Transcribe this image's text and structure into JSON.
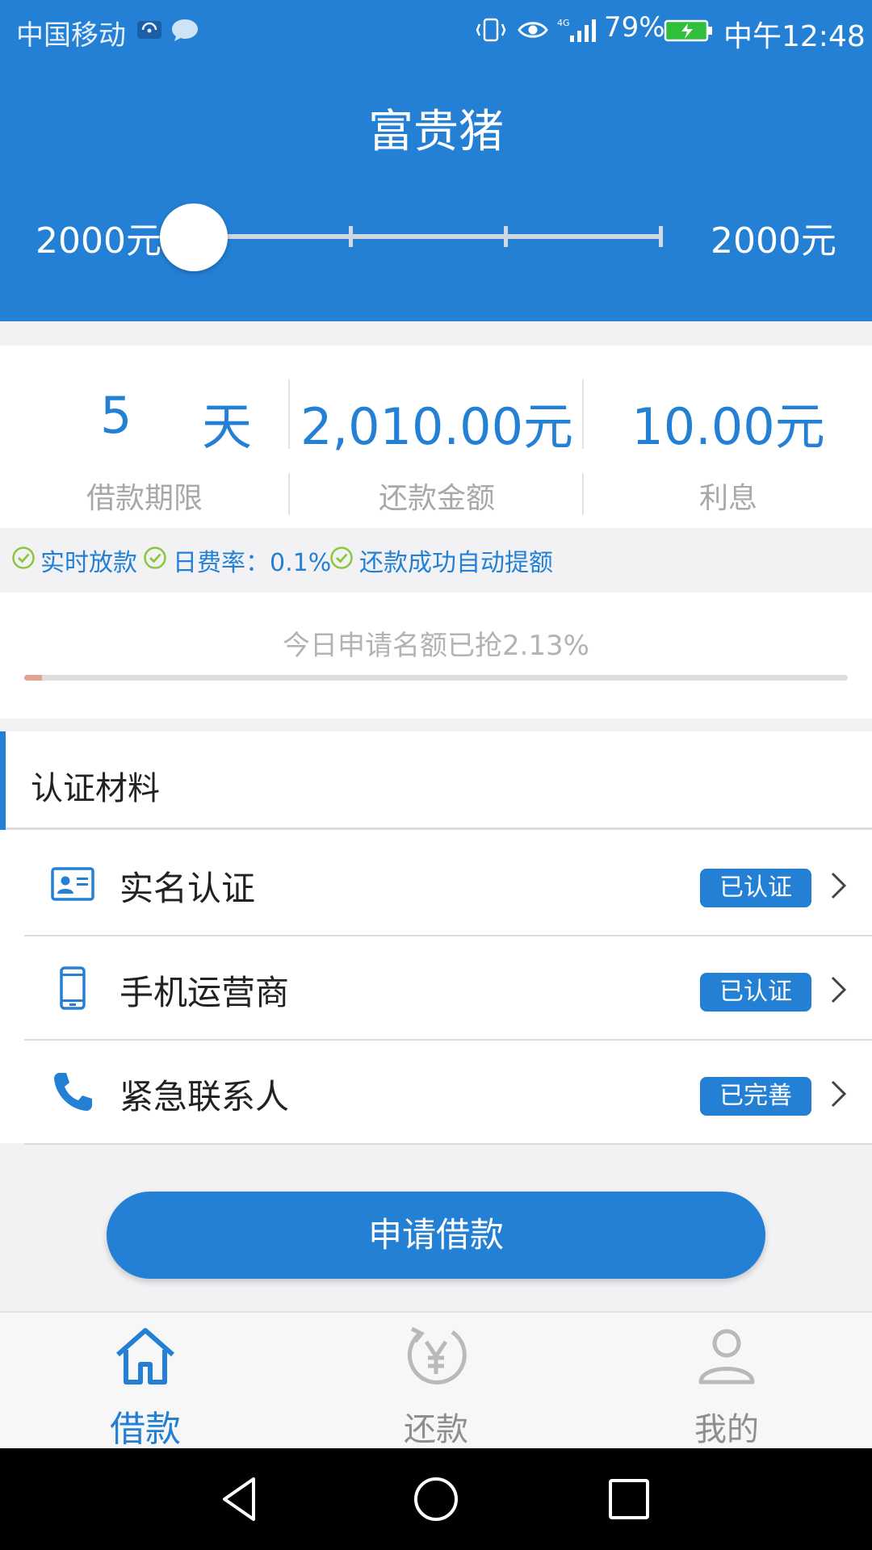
{
  "status_bar": {
    "carrier": "中国移动",
    "battery": "79%",
    "time": "中午12:48",
    "icons": [
      "wifi-hotspot-icon",
      "message-icon",
      "vibrate-icon",
      "eye-icon",
      "signal-4g-icon",
      "battery-charging-icon"
    ]
  },
  "header": {
    "title": "富贵猪",
    "amount_min": "2000元",
    "amount_max": "2000元",
    "slider_position": 0
  },
  "summary": {
    "term_value": "5",
    "term_unit": "天",
    "term_label": "借款期限",
    "repay_value": "2,010.00元",
    "repay_label": "还款金额",
    "interest_value": "10.00元",
    "interest_label": "利息"
  },
  "features": [
    "实时放款",
    "日费率：0.1%",
    "还款成功自动提额"
  ],
  "progress": {
    "text": "今日申请名额已抢2.13%",
    "percent": 2.13
  },
  "certification": {
    "title": "认证材料",
    "items": [
      {
        "label": "实名认证",
        "status": "已认证",
        "icon": "id-card-icon"
      },
      {
        "label": "手机运营商",
        "status": "已认证",
        "icon": "mobile-phone-icon"
      },
      {
        "label": "紧急联系人",
        "status": "已完善",
        "icon": "phone-call-icon"
      }
    ]
  },
  "apply_button": "申请借款",
  "tabs": [
    {
      "label": "借款",
      "icon": "home-icon",
      "active": true
    },
    {
      "label": "还款",
      "icon": "repay-yen-icon",
      "active": false
    },
    {
      "label": "我的",
      "icon": "user-icon",
      "active": false
    }
  ],
  "colors": {
    "primary": "#2380d4",
    "check_green": "#8cc63f",
    "progress_fill": "#e0a48f"
  }
}
